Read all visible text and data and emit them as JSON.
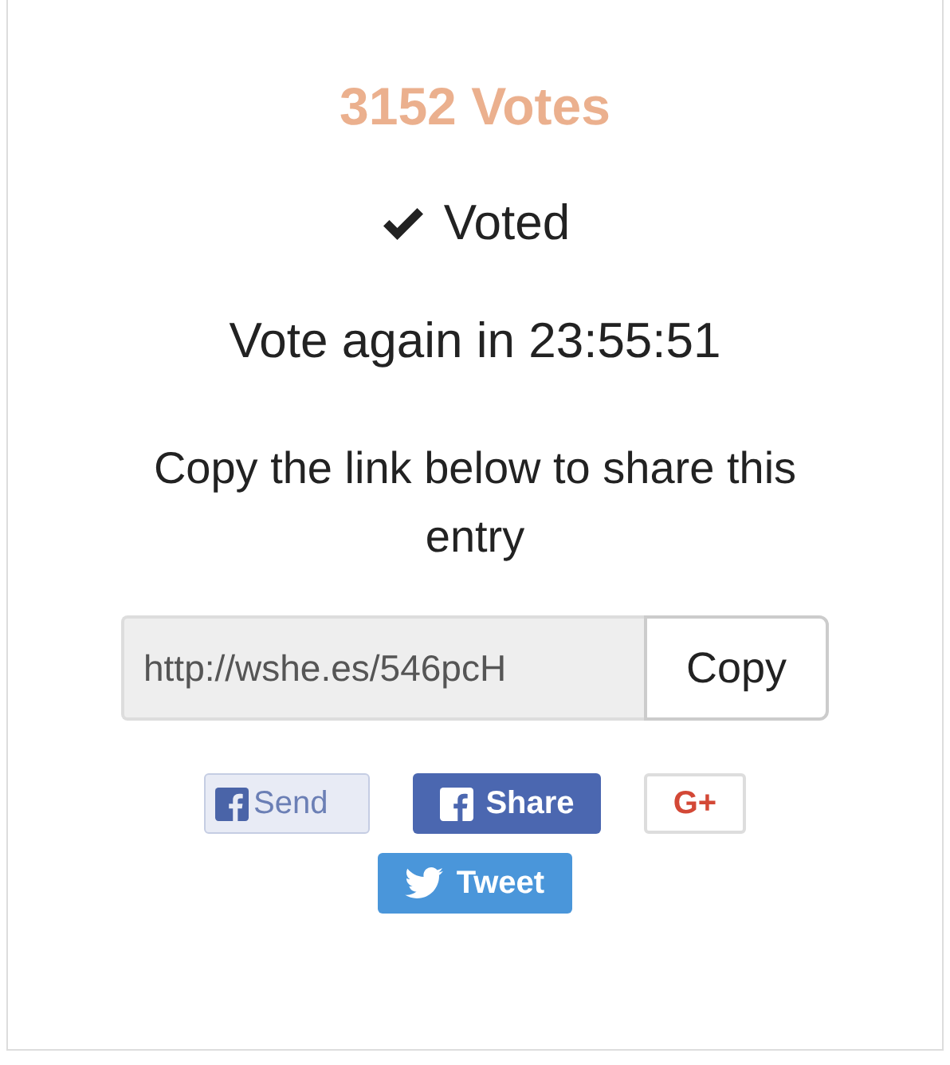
{
  "votes": "3152 Votes",
  "voted": {
    "label": "Voted",
    "checked": true
  },
  "countdown": "Vote again in 23:55:51",
  "share_text": "Copy the link below to share this entry",
  "link": {
    "value": "http://wshe.es/546pcH",
    "button": "Copy"
  },
  "social_buttons": [
    {
      "kind": "fb-send",
      "label": "Send"
    },
    {
      "kind": "fb-share",
      "label": "Share"
    },
    {
      "kind": "gplus",
      "label": "G+"
    },
    {
      "kind": "tweet",
      "label": "Tweet"
    }
  ]
}
